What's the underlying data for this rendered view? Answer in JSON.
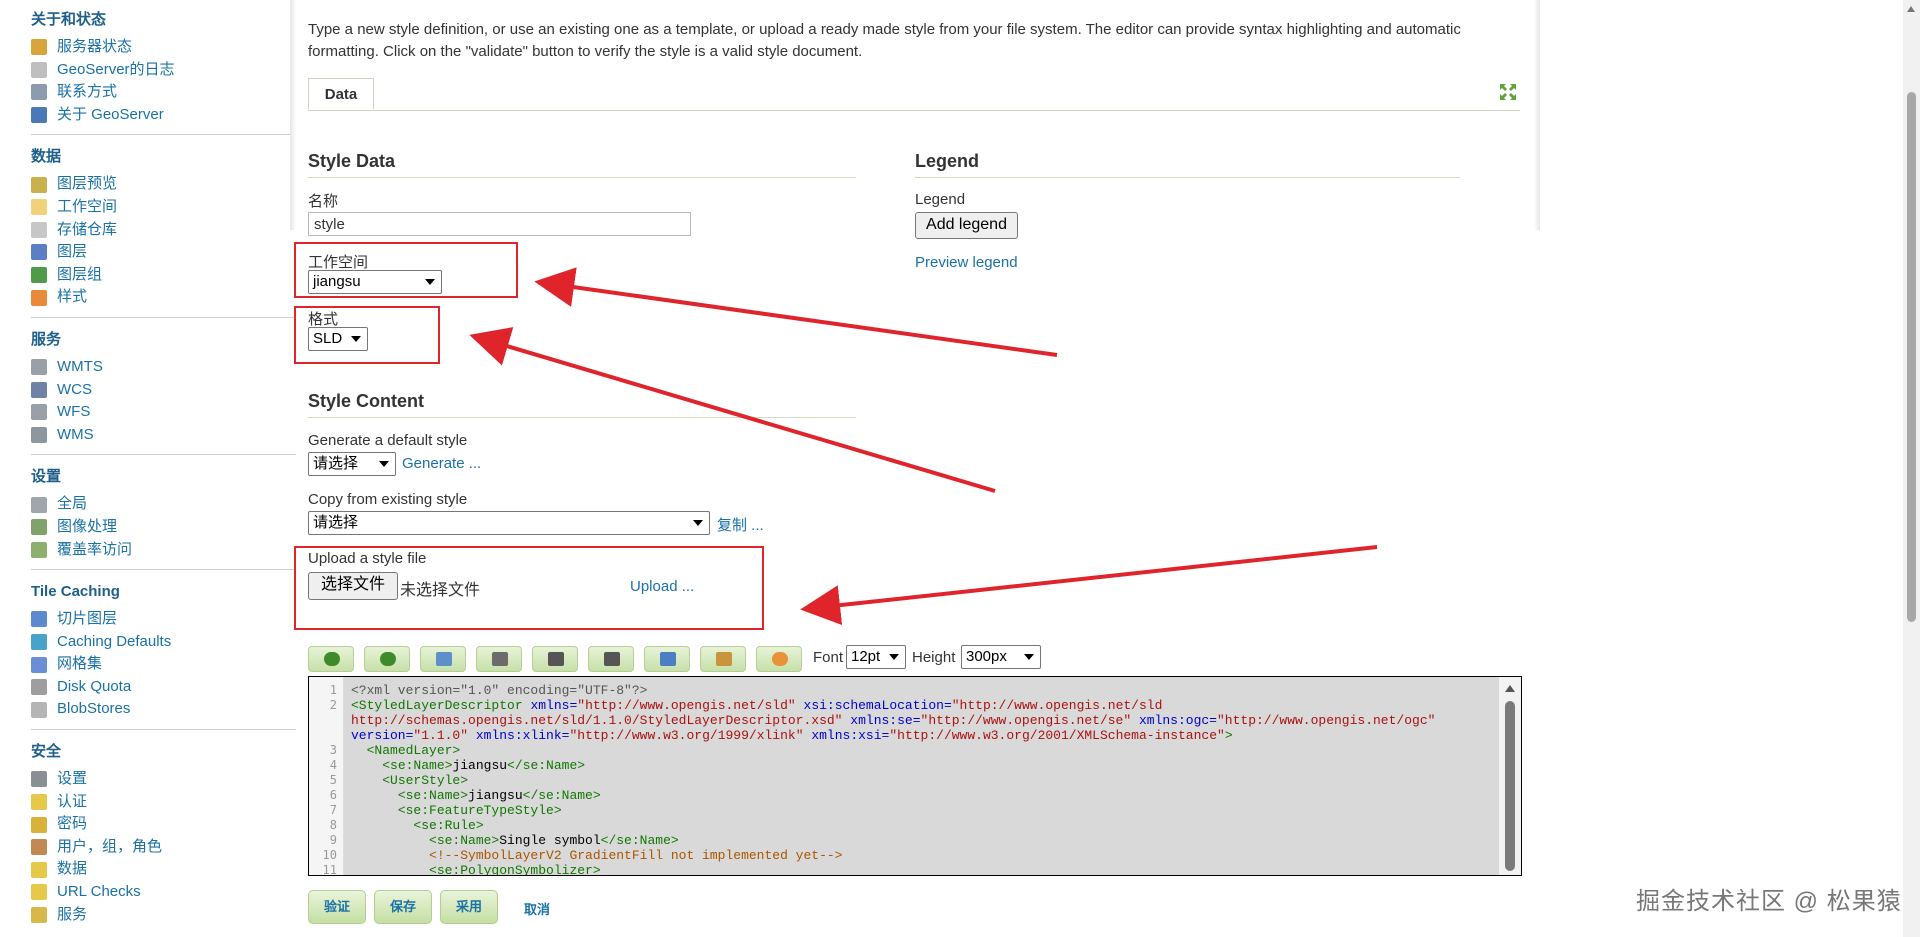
{
  "sidebar": {
    "sections": [
      {
        "title": "关于和状态",
        "items": [
          {
            "label": "服务器状态",
            "color": "#d9a53b"
          },
          {
            "label": "GeoServer的日志",
            "color": "#bfbfbf"
          },
          {
            "label": "联系方式",
            "color": "#8c9bb0"
          },
          {
            "label": "关于 GeoServer",
            "color": "#4a79b8"
          }
        ]
      },
      {
        "title": "数据",
        "items": [
          {
            "label": "图层预览",
            "color": "#c9b14b"
          },
          {
            "label": "工作空间",
            "color": "#f1d27a"
          },
          {
            "label": "存储仓库",
            "color": "#c7c7c7"
          },
          {
            "label": "图层",
            "color": "#5a7fc4"
          },
          {
            "label": "图层组",
            "color": "#4f9b49"
          },
          {
            "label": "样式",
            "color": "#e88a3a"
          }
        ]
      },
      {
        "title": "服务",
        "items": [
          {
            "label": "WMTS",
            "color": "#9aa0a8"
          },
          {
            "label": "WCS",
            "color": "#6f82a6"
          },
          {
            "label": "WFS",
            "color": "#9aa0a8"
          },
          {
            "label": "WMS",
            "color": "#8e96a0"
          }
        ]
      },
      {
        "title": "设置",
        "items": [
          {
            "label": "全局",
            "color": "#a0a6ad"
          },
          {
            "label": "图像处理",
            "color": "#7fa36b"
          },
          {
            "label": "覆盖率访问",
            "color": "#8eb06d"
          }
        ]
      },
      {
        "title": "Tile Caching",
        "items": [
          {
            "label": "切片图层",
            "color": "#5b8ad1"
          },
          {
            "label": "Caching Defaults",
            "color": "#47a3c9"
          },
          {
            "label": "网格集",
            "color": "#6a8fd6"
          },
          {
            "label": "Disk Quota",
            "color": "#9e9e9e"
          },
          {
            "label": "BlobStores",
            "color": "#b5b5b5"
          }
        ]
      },
      {
        "title": "安全",
        "items": [
          {
            "label": "设置",
            "color": "#8a8f96"
          },
          {
            "label": "认证",
            "color": "#e6c84a"
          },
          {
            "label": "密码",
            "color": "#d9b23b"
          },
          {
            "label": "用户，组，角色",
            "color": "#c08a52"
          },
          {
            "label": "数据",
            "color": "#e6c84a"
          },
          {
            "label": "URL Checks",
            "color": "#e6c84a"
          },
          {
            "label": "服务",
            "color": "#d8b84a"
          }
        ]
      }
    ]
  },
  "intro": "Type a new style definition, or use an existing one as a template, or upload a ready made style from your file system. The editor can provide syntax highlighting and automatic formatting. Click on the \"validate\" button to verify the style is a valid style document.",
  "tab": {
    "label": "Data"
  },
  "style_data": {
    "title": "Style Data",
    "name_label": "名称",
    "name_value": "style",
    "workspace_label": "工作空间",
    "workspace_value": "jiangsu",
    "format_label": "格式",
    "format_value": "SLD"
  },
  "legend": {
    "title": "Legend",
    "label": "Legend",
    "add_button": "Add legend",
    "preview_link": "Preview legend"
  },
  "style_content": {
    "title": "Style Content",
    "generate_label": "Generate a default style",
    "generate_select": "请选择",
    "generate_link": "Generate ...",
    "copy_label": "Copy from existing style",
    "copy_select": "请选择",
    "copy_link": "复制 ...",
    "upload_label": "Upload a style file",
    "choose_button": "选择文件",
    "no_file": "未选择文件",
    "upload_link": "Upload ..."
  },
  "toolbar": {
    "font_label": "Font",
    "font_value": "12pt",
    "height_label": "Height",
    "height_value": "300px"
  },
  "editor": {
    "line_numbers": [
      "1",
      "2",
      "",
      "",
      "3",
      "4",
      "5",
      "6",
      "7",
      "8",
      "9",
      "10",
      "11"
    ]
  },
  "buttons": {
    "validate": "验证",
    "save": "保存",
    "apply": "采用",
    "cancel": "取消"
  },
  "watermark": "掘金技术社区 @ 松果猿",
  "colors": {
    "annotation_red": "#e0242b",
    "link": "#1a71a6",
    "button_green": "#c4dfa3"
  }
}
